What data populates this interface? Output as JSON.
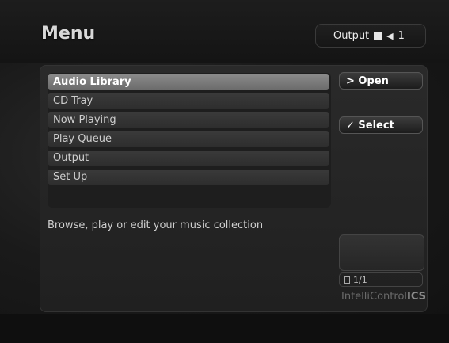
{
  "header": {
    "title": "Menu",
    "output_label": "Output",
    "output_volume": "1"
  },
  "menu": {
    "items": [
      {
        "label": "Audio Library"
      },
      {
        "label": "CD Tray"
      },
      {
        "label": "Now Playing"
      },
      {
        "label": "Play Queue"
      },
      {
        "label": "Output"
      },
      {
        "label": "Set Up"
      }
    ]
  },
  "description": "Browse, play or edit your music collection",
  "side": {
    "open_label": "> Open",
    "select_label": "✓ Select",
    "page": "1/1"
  },
  "brand": {
    "text": "IntelliControl",
    "bold": "ICS"
  }
}
